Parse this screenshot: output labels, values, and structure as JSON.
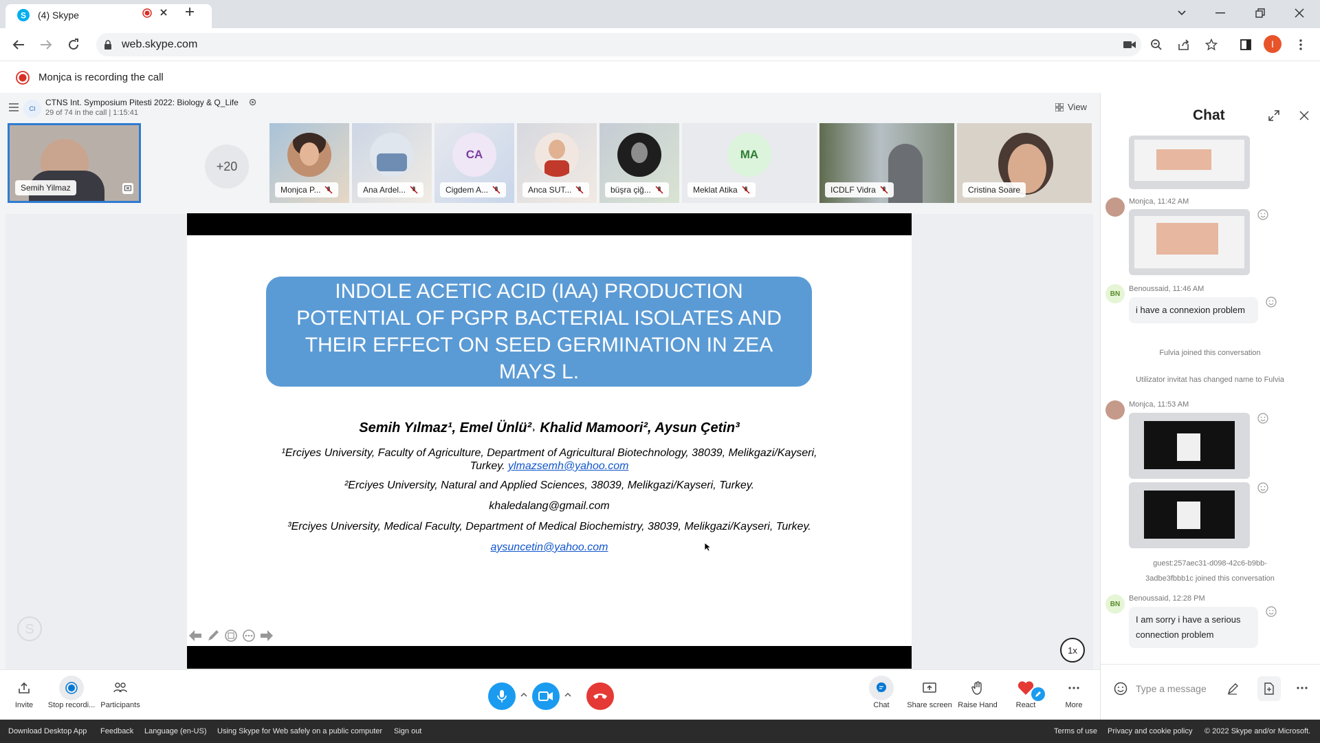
{
  "browser": {
    "tab_title": "(4) Skype",
    "url": "web.skype.com"
  },
  "recording_banner": "Monjca is recording the call",
  "call": {
    "title": "CTNS Int. Symposium Pitesti 2022: Biology & Q_Life",
    "subtitle": "29 of 74 in the call | 1:15:41",
    "view_label": "View",
    "overflow_count": "+20"
  },
  "participants": [
    {
      "name": "Semih Yilmaz"
    },
    {
      "name": "Monjca P..."
    },
    {
      "name": "Ana Ardel..."
    },
    {
      "name": "Cigdem A...",
      "initials": "CA"
    },
    {
      "name": "Anca SUT..."
    },
    {
      "name": "büşra çiğ..."
    },
    {
      "name": "Meklat Atika",
      "initials": "MA"
    },
    {
      "name": "ICDLF Vidra"
    },
    {
      "name": "Cristina Soare"
    }
  ],
  "slide": {
    "title": "INDOLE ACETIC ACID (IAA) PRODUCTION POTENTIAL OF PGPR BACTERIAL ISOLATES AND THEIR EFFECT ON SEED GERMINATION IN ZEA MAYS L.",
    "authors": "Semih Yılmaz¹, Emel Ünlü²˒ Khalid Mamoori²,  Aysun Çetin³",
    "affil1": "¹Erciyes University, Faculty of Agriculture, Department of Agricultural Biotechnology, 38039, Melikgazi/Kayseri,",
    "affil1b": "Turkey.",
    "email1": "ylmazsemh@yahoo.com",
    "affil2": "²Erciyes University, Natural and Applied Sciences, 38039, Melikgazi/Kayseri, Turkey.",
    "email2": "khaledalang@gmail.com",
    "affil3": "³Erciyes University, Medical Faculty, Department of Medical Biochemistry, 38039, Melikgazi/Kayseri, Turkey.",
    "email3": "aysuncetin@yahoo.com",
    "speed": "1x"
  },
  "callbar": {
    "invite": "Invite",
    "stop_recording": "Stop recordi...",
    "participants": "Participants",
    "chat": "Chat",
    "share_screen": "Share screen",
    "raise_hand": "Raise Hand",
    "react": "React",
    "more": "More"
  },
  "chat": {
    "title": "Chat",
    "msg1_meta": "Monjca, 11:42 AM",
    "msg2_meta": "Benoussaid, 11:46 AM",
    "msg2_text": "i have a connexion problem",
    "sys1": "Fulvia joined this conversation",
    "sys2": "Utilizator invitat has changed name to Fulvia",
    "msg3_meta": "Monjca, 11:53 AM",
    "sys3a": "guest:257aec31-d098-42c6-b9bb-",
    "sys3b": "3adbe3fbbb1c joined this conversation",
    "msg4_meta": "Benoussaid, 12:28 PM",
    "msg4_text": "I am sorry  i have a serious connection problem",
    "initials_bn": "BN",
    "input_placeholder": "Type a message"
  },
  "footer": {
    "download": "Download Desktop App",
    "feedback": "Feedback",
    "language": "Language (en-US)",
    "public": "Using Skype for Web safely on a public computer",
    "signout": "Sign out",
    "terms": "Terms of use",
    "privacy": "Privacy and cookie policy",
    "copyright": "© 2022 Skype and/or Microsoft."
  },
  "colors": {
    "skype_blue": "#0078d4",
    "hangup_red": "#e53935",
    "slide_title_bg": "#5b9bd5"
  }
}
